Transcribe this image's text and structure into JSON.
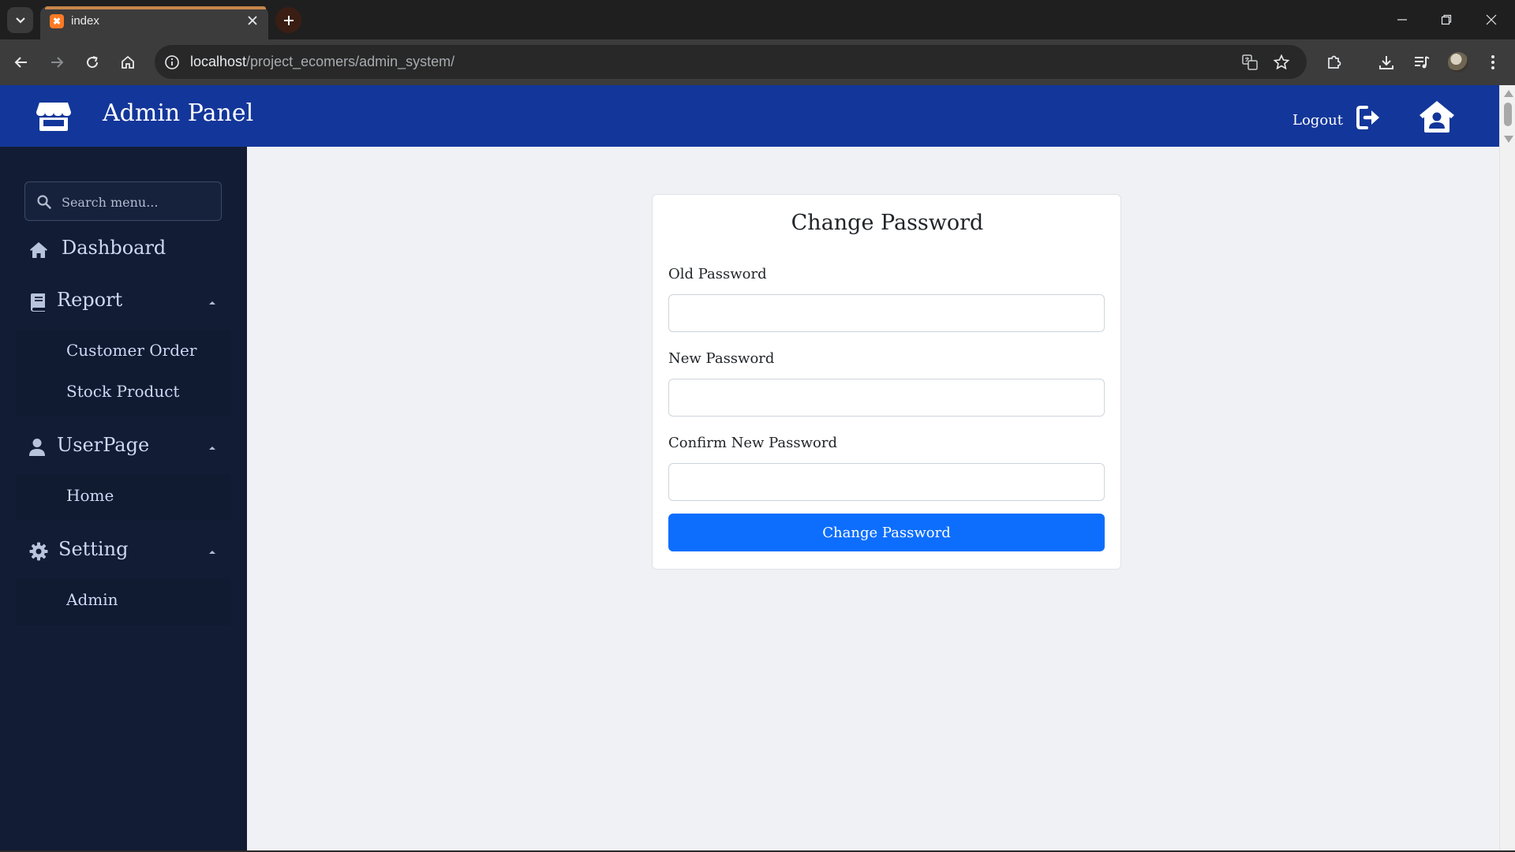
{
  "browser": {
    "tab_title": "index",
    "url_host": "localhost",
    "url_path": "/project_ecomers/admin_system/"
  },
  "header": {
    "title": "Admin Panel",
    "logout_label": "Logout",
    "color": "#13369a"
  },
  "sidebar": {
    "search_placeholder": "Search menu...",
    "menu": {
      "dashboard": "Dashboard",
      "report": "Report",
      "report_items": [
        "Customer Order",
        "Stock Product"
      ],
      "userpage": "UserPage",
      "userpage_items": [
        "Home"
      ],
      "setting": "Setting",
      "setting_items": [
        "Admin"
      ]
    }
  },
  "form": {
    "title": "Change Password",
    "old_password_label": "Old Password",
    "new_password_label": "New Password",
    "confirm_password_label": "Confirm New Password",
    "submit_label": "Change Password",
    "button_color": "#0d6efd"
  }
}
